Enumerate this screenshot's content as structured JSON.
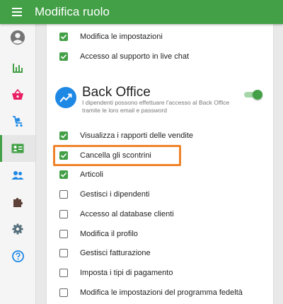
{
  "appbar": {
    "title": "Modifica ruolo",
    "menu_icon": "menu-icon"
  },
  "sidebar": {
    "items": [
      {
        "name": "account",
        "icon": "account-circle-icon",
        "color": "#757575",
        "active": false
      },
      {
        "name": "reports",
        "icon": "bar-chart-icon",
        "color": "#43a047",
        "active": false
      },
      {
        "name": "items",
        "icon": "basket-icon",
        "color": "#e91e63",
        "active": false
      },
      {
        "name": "inventory",
        "icon": "cart-icon",
        "color": "#1e88e5",
        "active": false
      },
      {
        "name": "employees",
        "icon": "badge-icon",
        "color": "#43a047",
        "active": true
      },
      {
        "name": "customers",
        "icon": "people-icon",
        "color": "#1e88e5",
        "active": false
      },
      {
        "name": "integrations",
        "icon": "puzzle-icon",
        "color": "#5d4037",
        "active": false
      },
      {
        "name": "settings",
        "icon": "gear-icon",
        "color": "#546e7a",
        "active": false
      },
      {
        "name": "help",
        "icon": "help-icon",
        "color": "#1e88e5",
        "active": false
      }
    ]
  },
  "pos_permissions": [
    {
      "label": "Modifica le impostazioni",
      "checked": true
    },
    {
      "label": "Accesso al supporto in live chat",
      "checked": true
    }
  ],
  "backoffice": {
    "title": "Back Office",
    "description": "I dipendenti possono effettuare l'accesso al Back Office tramite le loro email e password",
    "enabled": true,
    "permissions": [
      {
        "label": "Visualizza i rapporti delle vendite",
        "checked": true
      },
      {
        "label": "Cancella gli scontrini",
        "checked": true
      },
      {
        "label": "Articoli",
        "checked": true
      },
      {
        "label": "Gestisci i dipendenti",
        "checked": false
      },
      {
        "label": "Accesso al database clienti",
        "checked": false
      },
      {
        "label": "Modifica il profilo",
        "checked": false
      },
      {
        "label": "Gestisci fatturazione",
        "checked": false
      },
      {
        "label": "Imposta i tipi di pagamento",
        "checked": false
      },
      {
        "label": "Modifica le impostazioni del programma fedeltà",
        "checked": false
      }
    ]
  },
  "colors": {
    "accent": "#43a047",
    "highlight": "#f0832a",
    "section_icon": "#1e88e5"
  }
}
